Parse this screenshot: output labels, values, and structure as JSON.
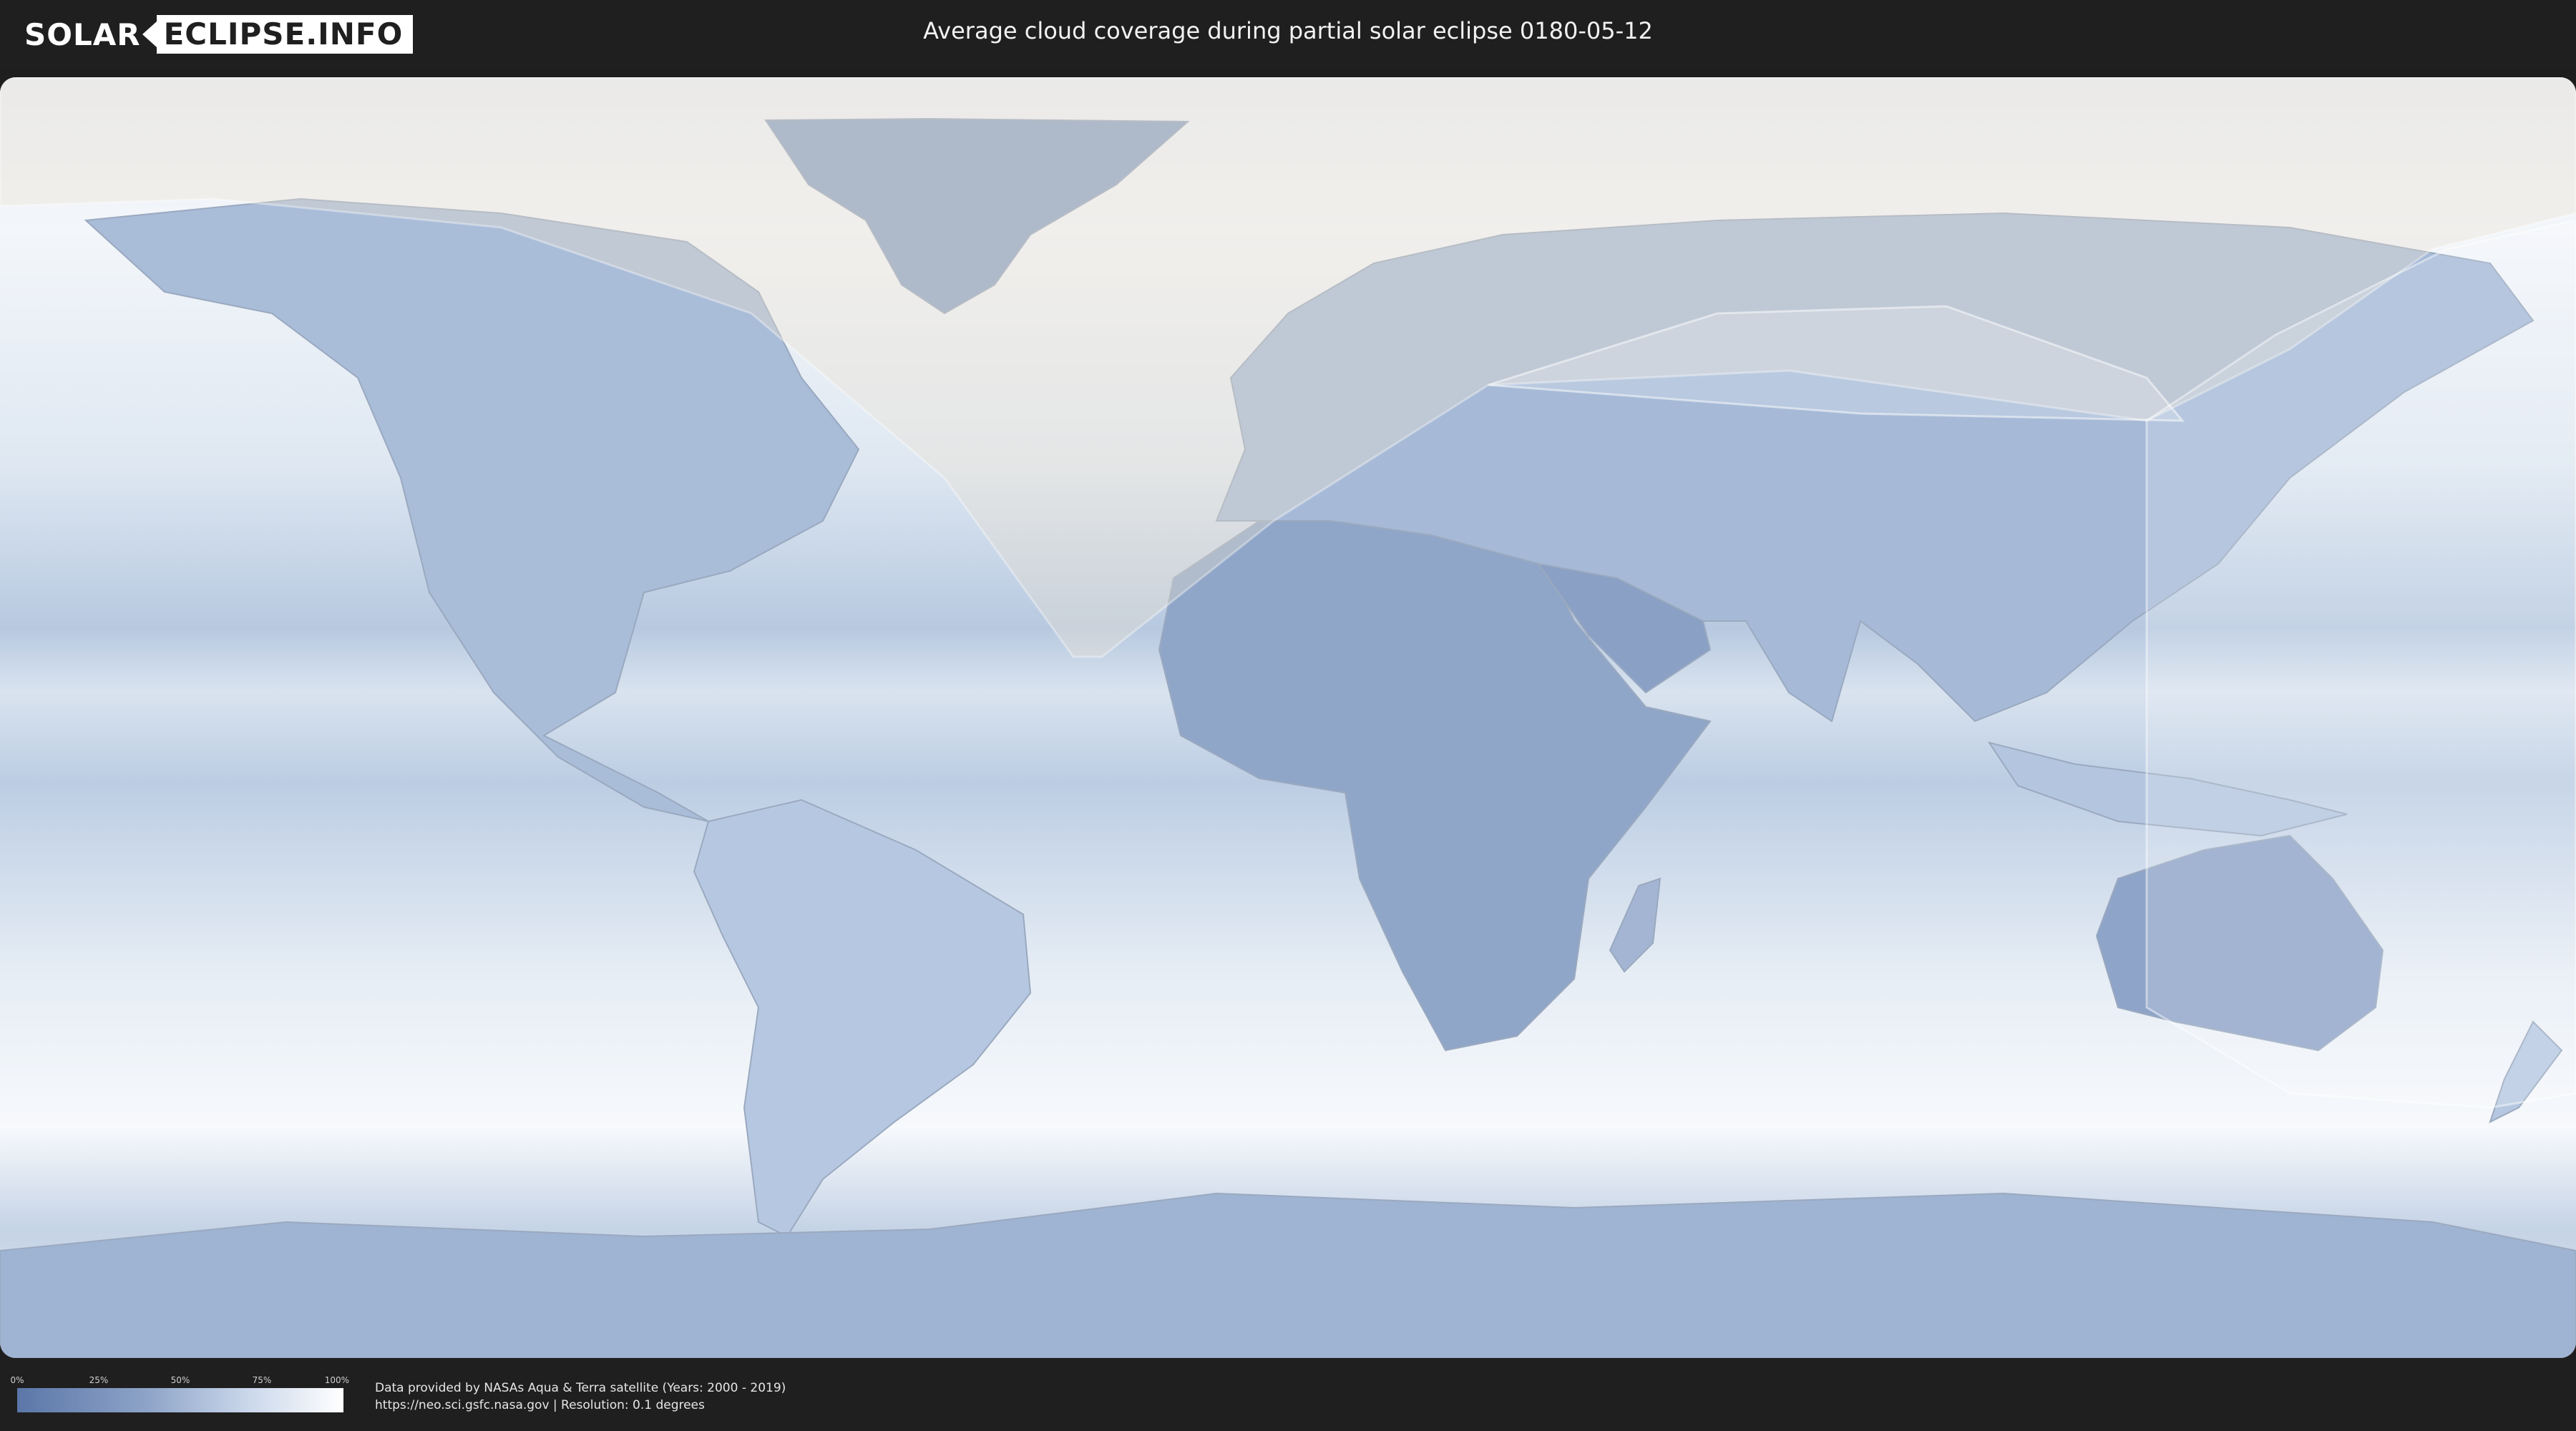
{
  "header": {
    "logo_left": "SOLAR",
    "logo_right": "ECLIPSE.INFO",
    "title": "Average cloud coverage during partial solar eclipse 0180-05-12"
  },
  "colors": {
    "cloud_clear": "#5b76a8",
    "cloud_full": "#ffffff",
    "ocean_base": "#b9cbe2",
    "eclipse_overlay": "#e8dccd"
  },
  "legend": {
    "ticks": [
      "0%",
      "25%",
      "50%",
      "75%",
      "100%"
    ]
  },
  "credits": {
    "line1": "Data provided by NASAs Aqua & Terra satellite (Years: 2000 - 2019)",
    "line2": "https://neo.sci.gsfc.nasa.gov | Resolution: 0.1 degrees"
  }
}
